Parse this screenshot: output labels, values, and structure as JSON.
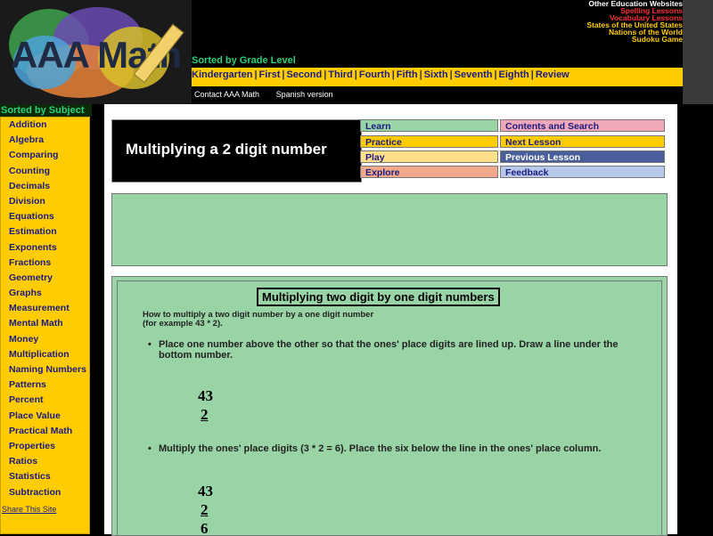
{
  "site": {
    "logo_text": "AAA Math",
    "top_links": [
      {
        "label": "Other Education Websites",
        "color": "#ffffff"
      },
      {
        "label": "Spelling Lessons",
        "color": "#ff3333"
      },
      {
        "label": "Vocabulary Lessons",
        "color": "#ff3333"
      },
      {
        "label": "States of the United States",
        "color": "#ffcc00"
      },
      {
        "label": "Nations of the World",
        "color": "#ffcc00"
      },
      {
        "label": "Sudoku Game",
        "color": "#ffcc00"
      }
    ],
    "grade_label": "Sorted by Grade Level",
    "grades": [
      "Kindergarten",
      "First",
      "Second",
      "Third",
      "Fourth",
      "Fifth",
      "Sixth",
      "Seventh",
      "Eighth",
      "Review"
    ],
    "sub_links": [
      "Contact AAA Math",
      "Spanish version"
    ]
  },
  "sidebar": {
    "label": "Sorted by Subject",
    "items": [
      "Addition",
      "Algebra",
      "Comparing",
      "Counting",
      "Decimals",
      "Division",
      "Equations",
      "Estimation",
      "Exponents",
      "Fractions",
      "Geometry",
      "Graphs",
      "Measurement",
      "Mental Math",
      "Money",
      "Multiplication",
      "Naming Numbers",
      "Patterns",
      "Percent",
      "Place Value",
      "Practical Math",
      "Properties",
      "Ratios",
      "Statistics",
      "Subtraction"
    ],
    "share": "Share This Site"
  },
  "lesson": {
    "page_title": "Multiplying a 2 digit number",
    "nav": {
      "learn": "Learn",
      "practice": "Practice",
      "play": "Play",
      "explore": "Explore",
      "contents": "Contents and Search",
      "next": "Next Lesson",
      "previous": "Previous Lesson",
      "feedback": "Feedback"
    },
    "heading": "Multiplying two digit by one digit numbers",
    "intro_line1": "How to multiply a two digit number by a one digit number",
    "intro_line2": "(for example 43 * 2).",
    "step1": "Place one number above the other so that the ones' place digits are lined up. Draw a line under the bottom number.",
    "step2": "Multiply the ones' place digits (3 * 2 = 6). Place the six below the line in the ones' place column.",
    "ex1": {
      "top": "43",
      "bottom": "2"
    },
    "ex2": {
      "top": "43",
      "bottom": "2",
      "result": "6"
    }
  },
  "colors": {
    "yellow": "#ffcc00",
    "green_panel": "#99d4a7",
    "learn": "#99d4a7",
    "practice": "#ffcc00",
    "play": "#ffe08a",
    "explore": "#f0a98a",
    "contents": "#f0a8b8",
    "next": "#ffcc00",
    "previous": "#4a5e9a",
    "feedback": "#b8c8e8"
  }
}
